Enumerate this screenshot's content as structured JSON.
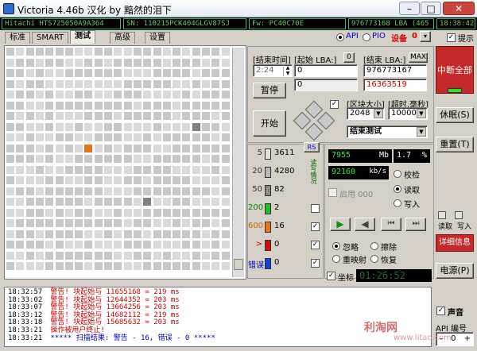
{
  "window": {
    "title": "Victoria 4.46b 汉化 by 黯然的泪下",
    "min": "–",
    "max": "□",
    "close": "✕"
  },
  "infobar": {
    "model": "Hitachi HTS725050A9A364",
    "serial": "SN: 110215PCK404GLGV87SJ",
    "firmware": "Fw: PC40C70E",
    "capacity": "976773168 LBA (465 GB)",
    "clock": "18:38:42"
  },
  "tabs": [
    "标准",
    "SMART",
    "测试",
    "高级",
    "设置"
  ],
  "active_tab": "测试",
  "mode": {
    "api": "API",
    "pio": "PIO",
    "device_label": "设备",
    "device_num": "0",
    "hint": "提示"
  },
  "colors": {
    "accent_red": "#c42a2a",
    "lcd_green": "#38e838",
    "orange": "#e07818",
    "blue_led": "#2c6fc8"
  },
  "grid": {
    "cols": 23,
    "rows": 24,
    "filled_rows": 21,
    "partial_cols_last_row": 0,
    "highlight_blocks": [
      {
        "row": 9,
        "col": 8,
        "kind": "orange"
      },
      {
        "row": 7,
        "col": 19,
        "kind": "dark"
      },
      {
        "row": 14,
        "col": 14,
        "kind": "dark"
      }
    ]
  },
  "controls": {
    "end_time_label": "[结束时间]",
    "start_lba_label": "[起始 LBA:]",
    "start_lba_btn": "0",
    "end_lba_label": "[结束 LBA:]",
    "end_lba_btn": "MAX",
    "time_value": "2:24",
    "start_lba_value": "0",
    "end_lba_value": "976773167",
    "current_lba_value": "0",
    "second_lba_value": "16363519",
    "pause": "暂停",
    "start": "开始",
    "block_size_label": "[区块大小]",
    "timeout_label": "[超时,毫秒]",
    "block_size_value": "2048",
    "timeout_value": "10000",
    "end_test_value": "结束测试"
  },
  "stats": {
    "rows": [
      {
        "ms": "5",
        "count": "3611",
        "color": "#e0e0e0"
      },
      {
        "ms": "20",
        "count": "4280",
        "color": "#b8b8b8"
      },
      {
        "ms": "50",
        "count": "82",
        "color": "#8a8a8a"
      },
      {
        "ms": "200",
        "count": "2",
        "color": "#22bb22"
      },
      {
        "ms": "600",
        "count": "16",
        "color": "#e07818"
      },
      {
        "ms": ">",
        "count": "0",
        "color": "#d01010"
      },
      {
        "ms": "错误",
        "count": "0",
        "color": "#1c3fd8"
      }
    ],
    "rs": "RS",
    "vertical_label": "读写情况"
  },
  "meters": {
    "mb": "7955",
    "mb_unit": "Mb",
    "percent": "1.7",
    "percent_unit": "%",
    "speed": "92160",
    "speed_unit": "kb/s",
    "enable_label": "启用 000",
    "verify": "校检",
    "read": "读取",
    "write": "写入",
    "ignore": "忽略",
    "erase": "擦除",
    "remap": "重映射",
    "restore": "恢复",
    "coords_label": "坐标",
    "coords_value": "01:26:52"
  },
  "side": {
    "abort_all": "中断全部",
    "sleep": "休眠(S)",
    "reset": "重置(T)",
    "read_label": "读取",
    "write_label": "写入",
    "details": "详细信息",
    "power": "电源(P)",
    "sound": "声音",
    "api_num": "API 编号",
    "api_value": "0"
  },
  "log": [
    {
      "time": "18:32:57",
      "msg": "警告! 块起始与 11655168 = 219 ms",
      "kind": "red"
    },
    {
      "time": "18:33:02",
      "msg": "警告! 块起始与 12644352 = 203 ms",
      "kind": "red"
    },
    {
      "time": "18:33:07",
      "msg": "警告! 块起始与 13664256 = 203 ms",
      "kind": "red"
    },
    {
      "time": "18:33:12",
      "msg": "警告! 块起始与 14682112 = 219 ms",
      "kind": "red"
    },
    {
      "time": "18:33:18",
      "msg": "警告! 块起始与 15685632 = 203 ms",
      "kind": "red"
    },
    {
      "time": "18:33:21",
      "msg": "操作被用户终止!",
      "kind": "red"
    },
    {
      "time": "18:33:21",
      "msg": "***** 扫描结果: 警告 - 16, 错误 - 0 *****",
      "kind": "blue"
    }
  ],
  "watermark": {
    "cn": "利淘网",
    "url": "www.litao.com"
  }
}
